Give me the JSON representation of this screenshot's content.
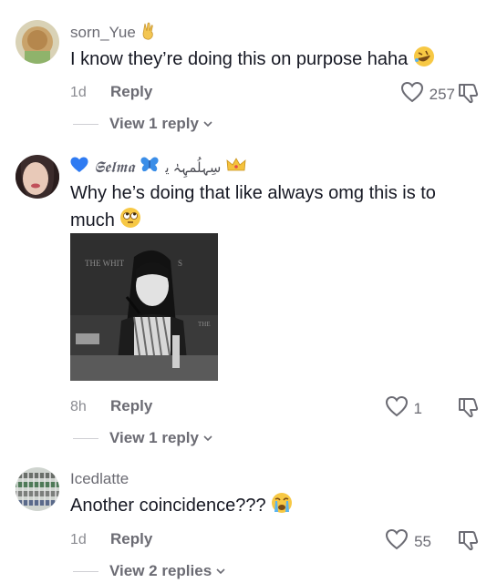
{
  "comments": [
    {
      "username": "sorn_Yue",
      "text": "I know they’re doing this on purpose haha",
      "time": "1d",
      "reply_label": "Reply",
      "likes": "257",
      "view_replies": "View 1 reply"
    },
    {
      "username": "𝕾𝖊𝖑𝖒𝖆",
      "username_suffix": "سِہلُمہِہٰ ﯾ",
      "text": "Why he’s doing that like always omg this is to much",
      "time": "8h",
      "reply_label": "Reply",
      "likes": "1",
      "view_replies": "View 1 reply",
      "image_caption": "THE WHIT"
    },
    {
      "username": "Icedlatte",
      "text": "Another coincidence???",
      "time": "1d",
      "reply_label": "Reply",
      "likes": "55",
      "view_replies": "View 2 replies"
    }
  ],
  "colors": {
    "text": "#161823",
    "muted": "#6b6b73",
    "time": "#8a8b91",
    "heart_blue": "#2f7bf2"
  },
  "icons": [
    "heart-outline-icon",
    "dislike-icon",
    "chevron-down-icon",
    "blue-heart-icon",
    "butterfly-icon",
    "crown-icon",
    "victory-hand-emoji",
    "rofl-emoji",
    "eye-roll-emoji",
    "crying-emoji"
  ]
}
